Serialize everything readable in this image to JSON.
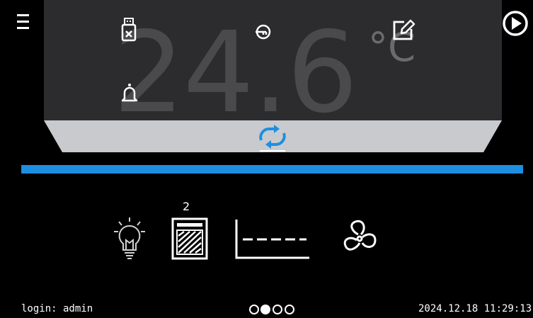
{
  "display": {
    "temperature": "24.6",
    "unit": "°C"
  },
  "status": {
    "chamber_count": "2"
  },
  "footer": {
    "login": "login: admin",
    "datetime": "2024.12.18 11:29:13",
    "page_count": 4,
    "active_page": 2
  },
  "colors": {
    "accent_blue": "#1e8fe0",
    "panel_dark": "#2c2c2e",
    "tray_gray": "#c9cacd",
    "digit_gray": "#4a4a4c"
  },
  "icons": {
    "menu": "hamburger-menu-icon",
    "play": "play-circle-icon",
    "usb": "usb-removed-icon",
    "key": "key-icon",
    "edit": "edit-icon",
    "alarm": "bell-icon",
    "swap": "swap-arrows-icon",
    "light": "light-bulb-icon",
    "oven": "chamber-icon",
    "program": "program-graph-icon",
    "fan": "fan-icon"
  }
}
